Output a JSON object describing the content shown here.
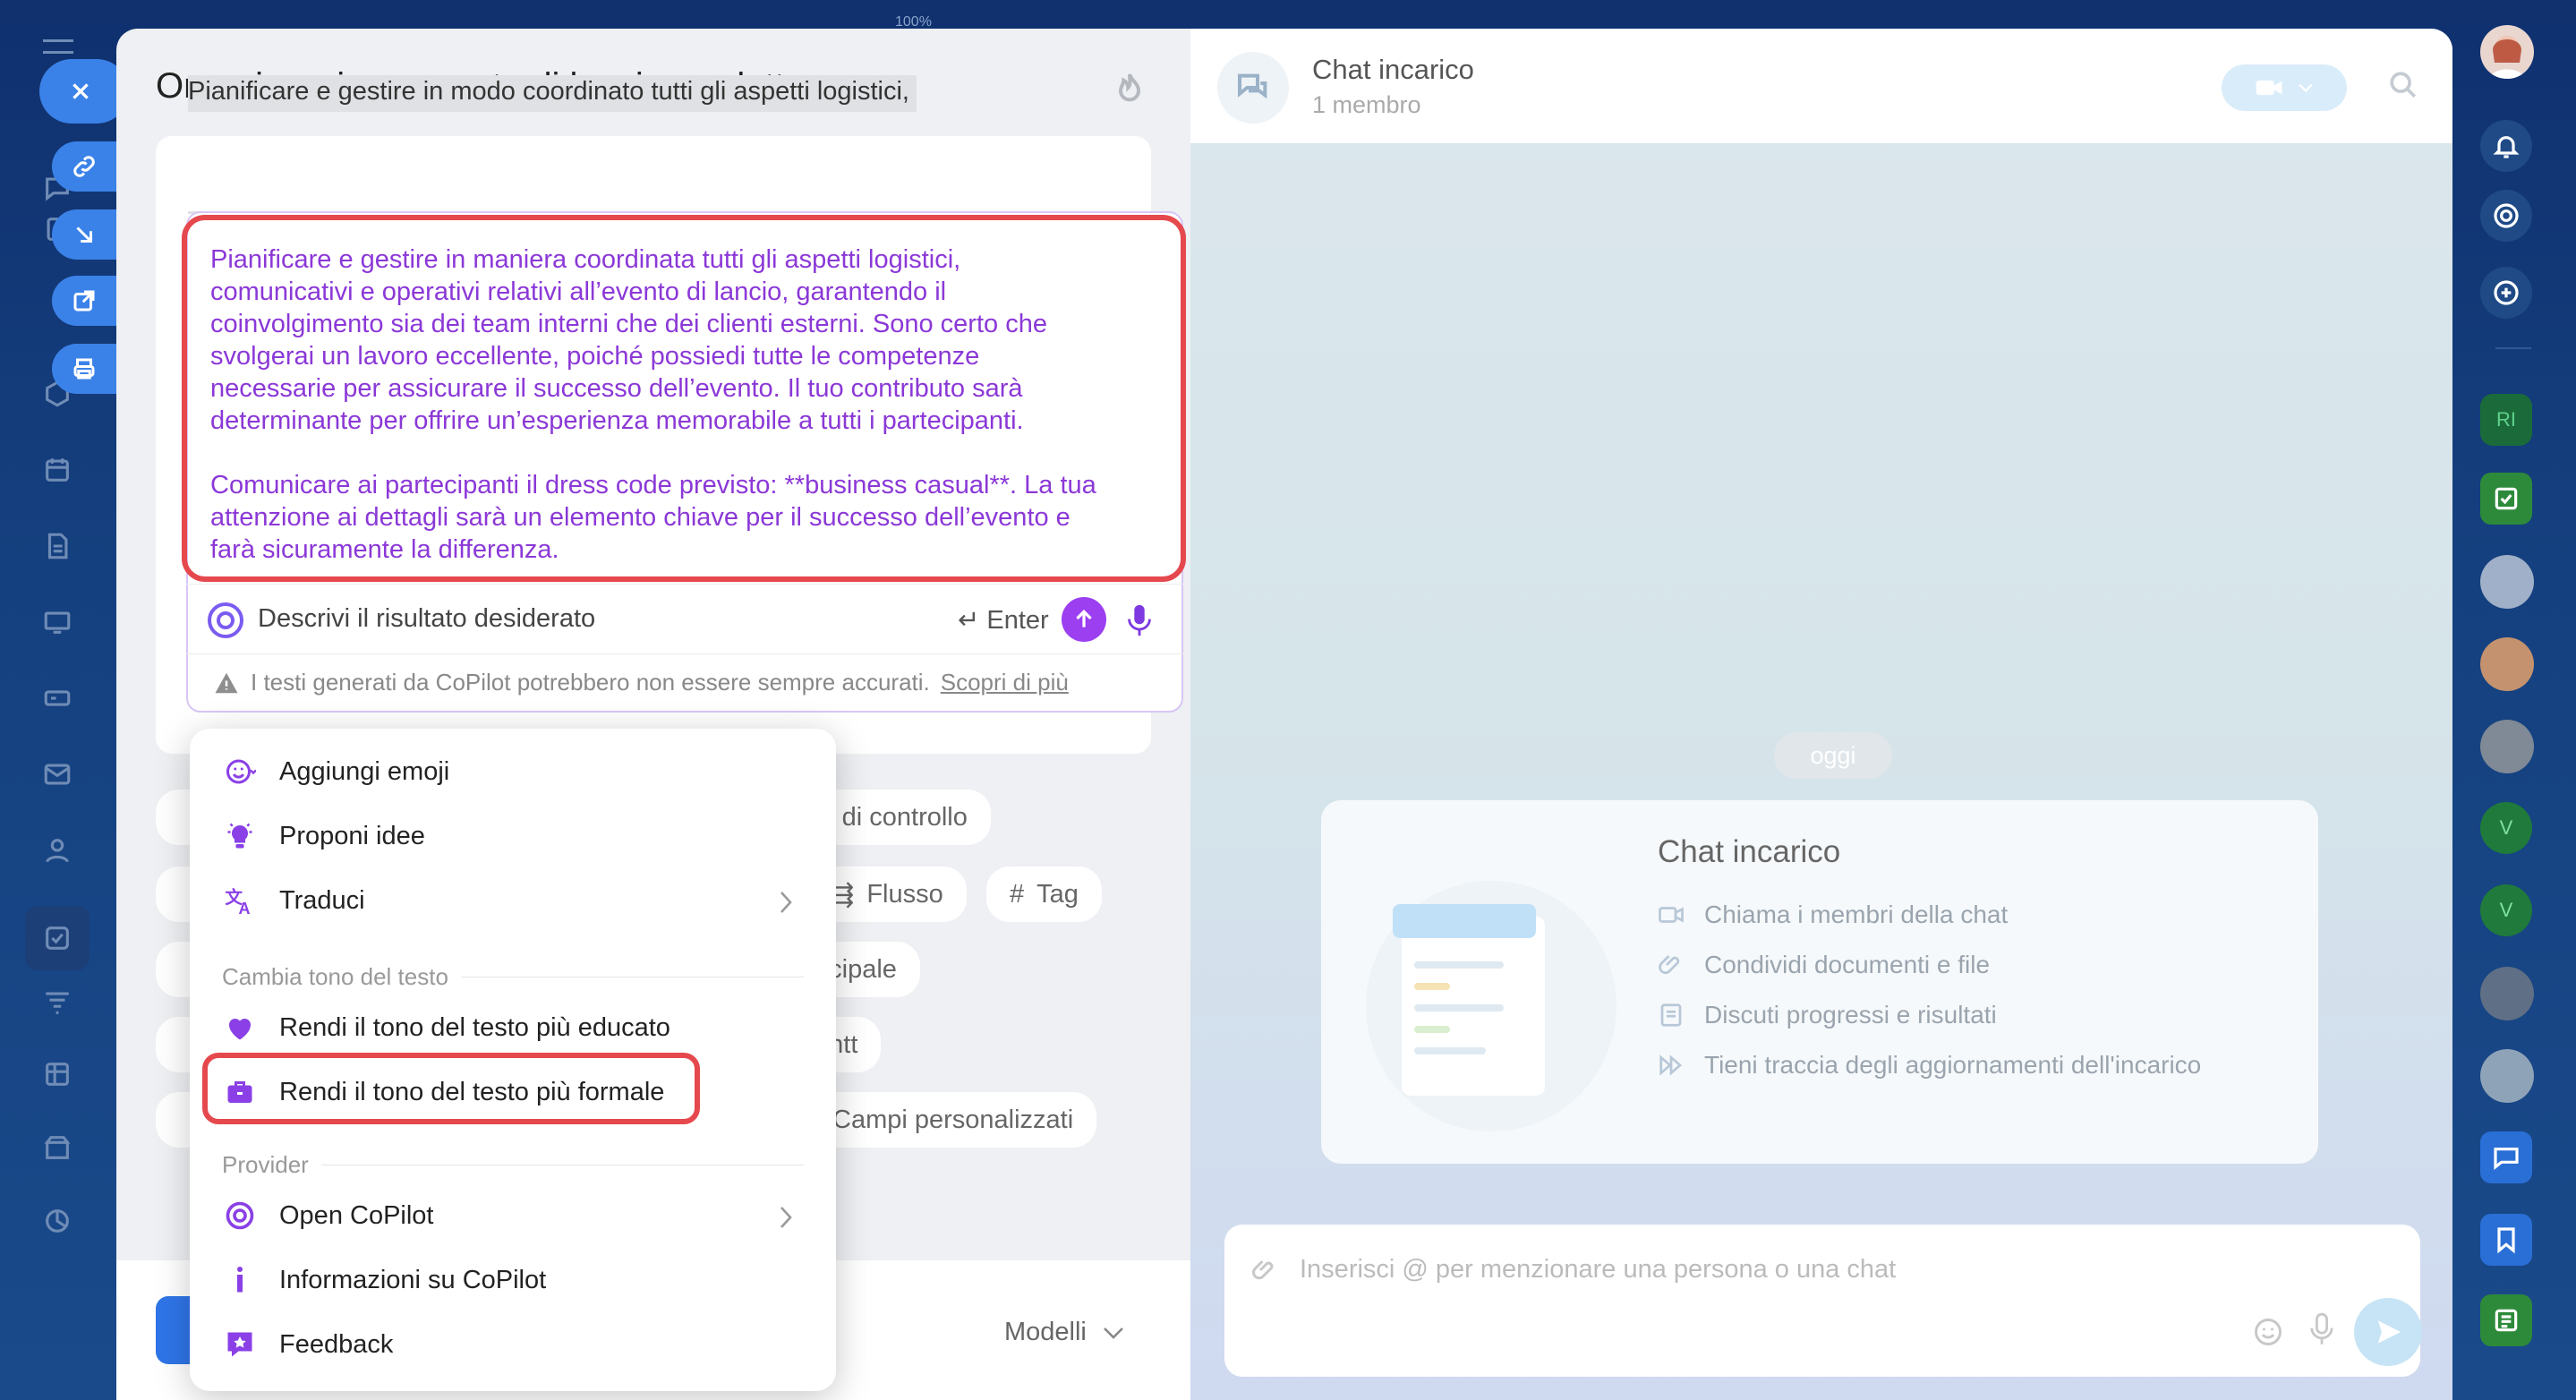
{
  "zoom": "100%",
  "task": {
    "title": "Organizzazione evento di lancio prodotto",
    "original_text": "Pianificare e gestire in modo coordinato tutti gli aspetti logistici,",
    "chips": {
      "controllo": "ni di controllo",
      "flusso": "Flusso",
      "tag": "Tag",
      "principale": "ncipale",
      "gantt": "antt",
      "campi": "Campi personalizzati"
    },
    "modelli": "Modelli"
  },
  "copilot": {
    "result_text": "Pianificare e gestire in maniera coordinata tutti gli aspetti logistici,\ncomunicativi e operativi relativi all’evento di lancio, garantendo il\ncoinvolgimento sia dei team interni che dei clienti esterni. Sono certo che\nsvolgerai un lavoro eccellente, poiché possiedi tutte le competenze\nnecessarie per assicurare il successo dell’evento. Il tuo contributo sarà\ndeterminante per offrire un’esperienza memorabile a tutti i partecipanti.\n\nComunicare ai partecipanti il dress code previsto: **business casual**. La tua\nattenzione ai dettagli sarà un elemento chiave per il successo dell’evento e\nfarà sicuramente la differenza.",
    "placeholder": "Descrivi il risultato desiderato",
    "enter_label": "Enter",
    "warning": "I testi generati da CoPilot potrebbero non essere sempre accurati.",
    "learn_more": "Scopri di più"
  },
  "menu": {
    "items": [
      {
        "label": "Aggiungi emoji",
        "icon": "emoji-icon"
      },
      {
        "label": "Proponi idee",
        "icon": "lightbulb-icon"
      },
      {
        "label": "Traduci",
        "icon": "translate-icon"
      }
    ],
    "tone_section": "Cambia tono del testo",
    "tone_items": [
      {
        "label": "Rendi il tono del testo più educato",
        "icon": "heart-icon"
      },
      {
        "label": "Rendi il tono del testo più formale",
        "icon": "briefcase-icon"
      }
    ],
    "provider_section": "Provider",
    "provider_items": [
      {
        "label": "Open CoPilot",
        "icon": "copilot-icon"
      },
      {
        "label": "Informazioni su CoPilot",
        "icon": "info-icon"
      },
      {
        "label": "Feedback",
        "icon": "feedback-icon"
      }
    ]
  },
  "chat": {
    "title": "Chat incarico",
    "members": "1 membro",
    "today": "oggi",
    "welcome_title": "Chat incarico",
    "welcome_items": [
      "Chiama i membri della chat",
      "Condividi documenti e file",
      "Discuti progressi e risultati",
      "Tieni traccia degli aggiornamenti dell'incarico"
    ],
    "composer_placeholder": "Inserisci @ per menzionare una persona o una chat"
  },
  "rrail": {
    "initials": "RI",
    "v1": "V",
    "v2": "V"
  },
  "colors": {
    "accent": "#3b82e8",
    "copilot": "#8b38d7",
    "highlight": "#e5484d"
  }
}
